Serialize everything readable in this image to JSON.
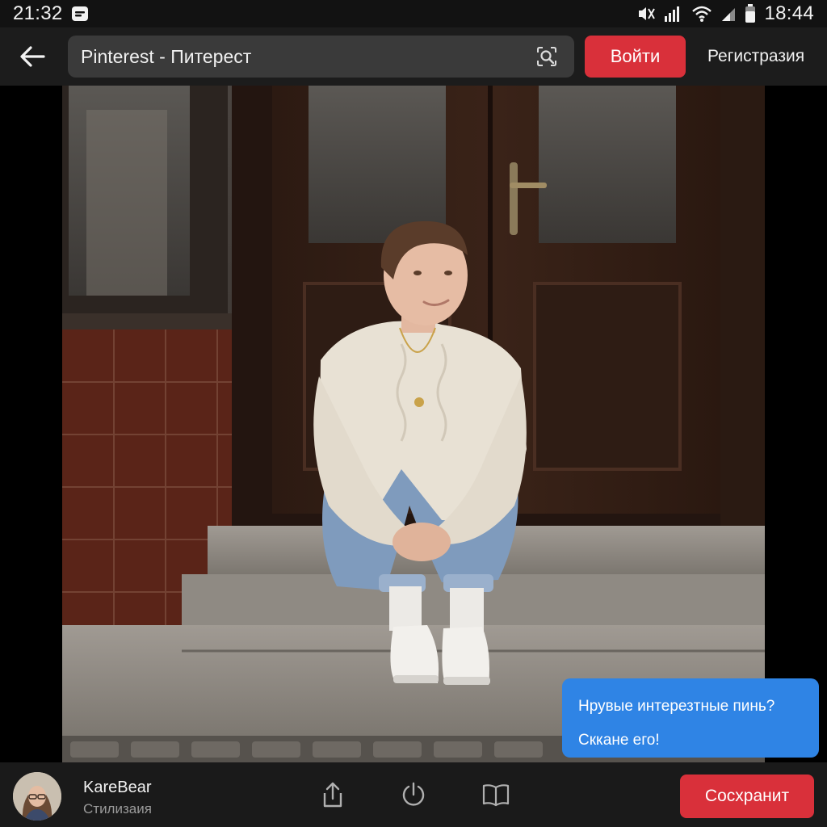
{
  "status_bar": {
    "time_left": "21:32",
    "time_right": "18:44",
    "icons": [
      "message-icon",
      "mute-vibrate-icon",
      "signal-icon",
      "wifi-icon",
      "battery-icon"
    ]
  },
  "header": {
    "url_text": "Pinterest - Питерест",
    "login_label": "Войти",
    "signup_label": "Регистразия"
  },
  "bubble": {
    "line1": "Нрувые интерезтные пинь?",
    "line2": "Скканe его!"
  },
  "footer": {
    "author_name": "KareBear",
    "author_subtitle": "Стилизаия",
    "save_label": "Сосхранит"
  },
  "colors": {
    "accent_red": "#d9303a",
    "bubble_blue": "#2f84e5",
    "header_bg": "#1c1c1c",
    "url_bar_bg": "#3a3a3a"
  }
}
